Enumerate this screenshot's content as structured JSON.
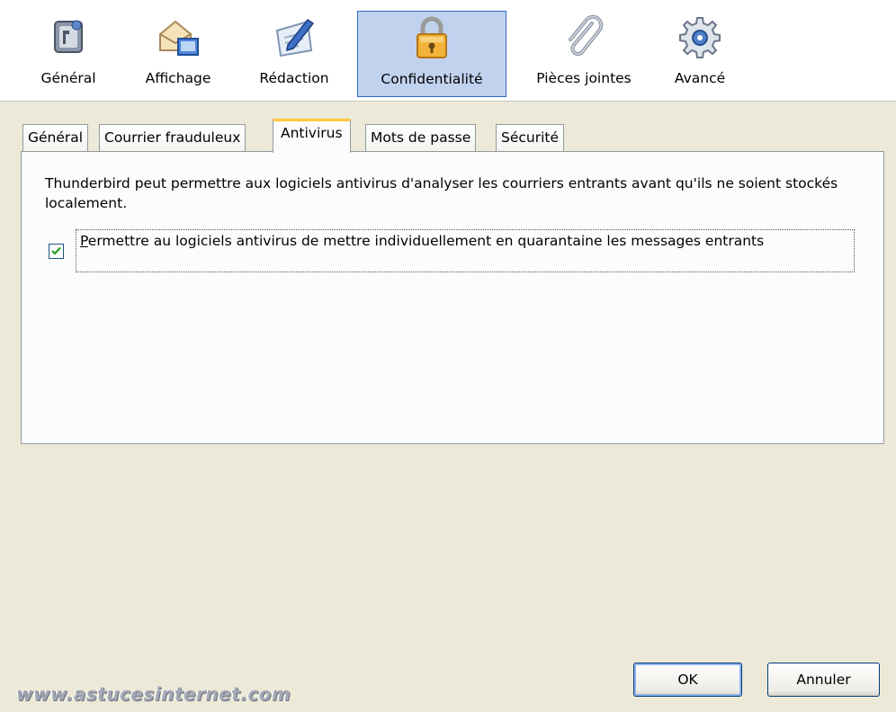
{
  "toolbar": {
    "buttons": [
      {
        "label": "Général",
        "icon": "general-settings-icon"
      },
      {
        "label": "Affichage",
        "icon": "display-envelope-icon"
      },
      {
        "label": "Rédaction",
        "icon": "compose-pen-icon"
      },
      {
        "label": "Confidentialité",
        "icon": "padlock-icon",
        "selected": true
      },
      {
        "label": "Pièces jointes",
        "icon": "paperclip-icon"
      },
      {
        "label": "Avancé",
        "icon": "gear-icon"
      }
    ]
  },
  "tabs": [
    {
      "label": "Général"
    },
    {
      "label": "Courrier frauduleux"
    },
    {
      "label": "Antivirus",
      "active": true
    },
    {
      "label": "Mots de passe"
    },
    {
      "label": "Sécurité"
    }
  ],
  "antivirus": {
    "description": "Thunderbird peut permettre aux logiciels antivirus d'analyser les courriers entrants avant qu'ils ne soient stockés localement.",
    "checkbox_checked": true,
    "checkbox_label_first": "P",
    "checkbox_label_rest": "ermettre au logiciels antivirus de mettre individuellement en quarantaine les messages entrants"
  },
  "buttons": {
    "ok": "OK",
    "cancel": "Annuler"
  },
  "watermark": "www.astucesinternet.com",
  "colors": {
    "selected_bg": "#c1d2ee",
    "selected_border": "#316ac5",
    "active_tab_accent": "#ffc83c",
    "dialog_bg": "#ece9d8"
  }
}
